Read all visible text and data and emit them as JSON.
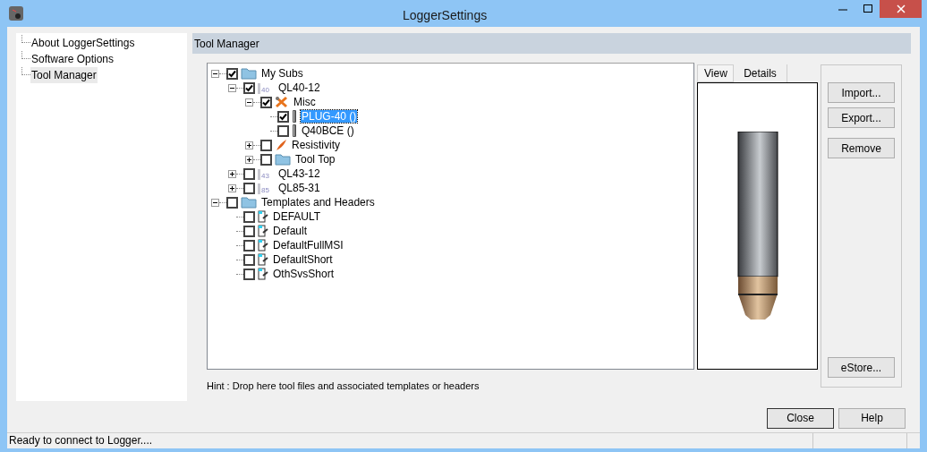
{
  "window": {
    "title": "LoggerSettings"
  },
  "nav": [
    {
      "label": "About LoggerSettings",
      "selected": false
    },
    {
      "label": "Software Options",
      "selected": false
    },
    {
      "label": "Tool Manager",
      "selected": true
    }
  ],
  "section_title": "Tool Manager",
  "tree": [
    {
      "label": "My Subs",
      "kind": "folder",
      "checked": true,
      "expanded": true,
      "selected": false,
      "children": [
        {
          "label": "QL40-12",
          "kind": "tool",
          "badge": "40",
          "checked": true,
          "expanded": true,
          "selected": false,
          "children": [
            {
              "label": "Misc",
              "kind": "misc",
              "checked": true,
              "expanded": true,
              "selected": false,
              "children": [
                {
                  "label": "PLUG-40 ()",
                  "kind": "probe",
                  "checked": true,
                  "selected": true
                },
                {
                  "label": "Q40BCE ()",
                  "kind": "probe",
                  "checked": false,
                  "selected": false
                }
              ]
            },
            {
              "label": "Resistivity",
              "kind": "resistivity",
              "checked": false,
              "expanded": false,
              "selected": false
            },
            {
              "label": "Tool Top",
              "kind": "folder",
              "checked": false,
              "expanded": false,
              "selected": false
            }
          ]
        },
        {
          "label": "QL43-12",
          "kind": "tool",
          "badge": "43",
          "checked": false,
          "expanded": false,
          "selected": false
        },
        {
          "label": "QL85-31",
          "kind": "tool",
          "badge": "85",
          "checked": false,
          "expanded": false,
          "selected": false
        }
      ]
    },
    {
      "label": "Templates and Headers",
      "kind": "folder",
      "checked": false,
      "expanded": true,
      "selected": false,
      "children": [
        {
          "label": "DEFAULT",
          "kind": "template",
          "checked": false,
          "selected": false
        },
        {
          "label": "Default",
          "kind": "template",
          "checked": false,
          "selected": false
        },
        {
          "label": "DefaultFullMSI",
          "kind": "template",
          "checked": false,
          "selected": false
        },
        {
          "label": "DefaultShort",
          "kind": "template",
          "checked": false,
          "selected": false
        },
        {
          "label": "OthSvsShort",
          "kind": "template",
          "checked": false,
          "selected": false
        }
      ]
    }
  ],
  "preview_tabs": [
    {
      "label": "View",
      "selected": true
    },
    {
      "label": "Details",
      "selected": false
    }
  ],
  "side_buttons": [
    "Import...",
    "Export...",
    "Remove"
  ],
  "store_button": "eStore...",
  "hint": "Hint : Drop here tool files and associated templates or headers",
  "dialog_buttons": [
    "Close",
    "Help"
  ],
  "status_bar": "Ready to connect to Logger...."
}
